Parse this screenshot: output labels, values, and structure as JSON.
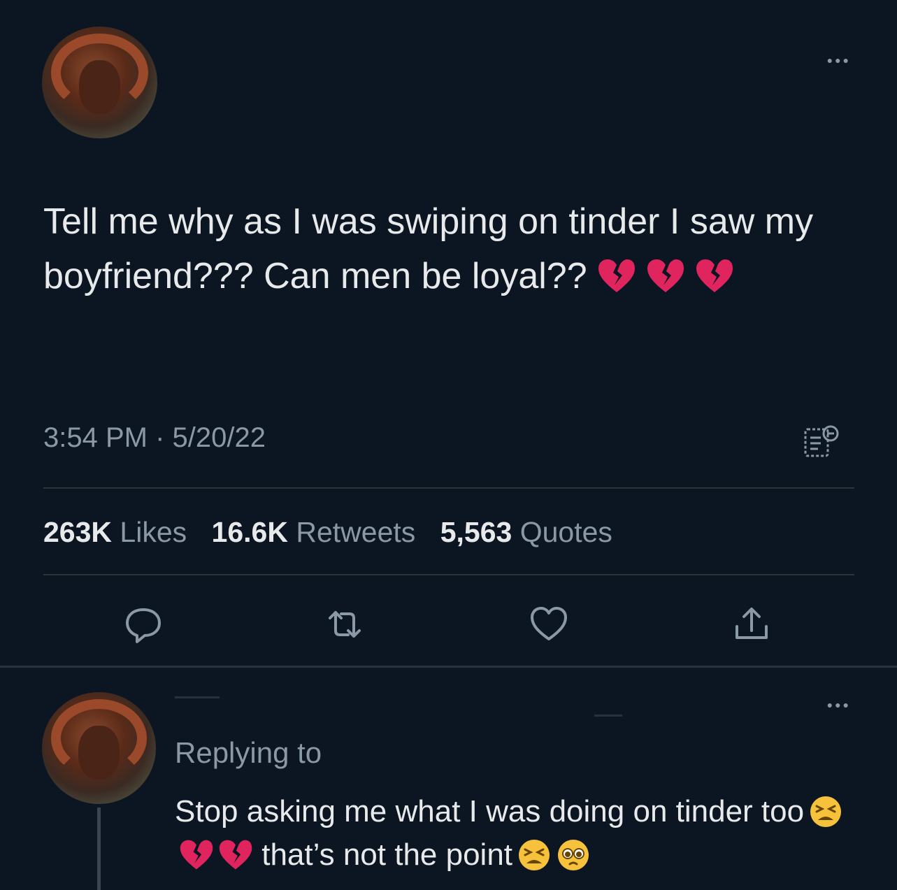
{
  "tweet": {
    "text": "Tell me why as I was swiping on tinder I saw my boyfriend??? Can men be loyal??",
    "timestamp": "3:54 PM · 5/20/22",
    "stats": {
      "likes_count": "263K",
      "likes_label": "Likes",
      "retweets_count": "16.6K",
      "retweets_label": "Retweets",
      "quotes_count": "5,563",
      "quotes_label": "Quotes"
    },
    "emoji_trailing": [
      "broken-heart",
      "broken-heart",
      "broken-heart"
    ]
  },
  "reply": {
    "replying_label": "Replying to",
    "text_part1": "Stop asking me what I was doing on tinder too",
    "text_part2": "that’s not the point",
    "emoji_middle": [
      "tired-face",
      "broken-heart",
      "broken-heart"
    ],
    "emoji_end": [
      "tired-face",
      "pleading-face"
    ]
  },
  "icons": {
    "more": "more-horizontal-icon",
    "analytics": "analytics-icon",
    "reply": "reply-icon",
    "retweet": "retweet-icon",
    "like": "like-icon",
    "share": "share-icon"
  },
  "colors": {
    "background": "#0b1622",
    "text_primary": "#e7e9ea",
    "text_secondary": "#8b98a5",
    "divider": "#2f3336",
    "broken_heart": "#e0245e"
  }
}
